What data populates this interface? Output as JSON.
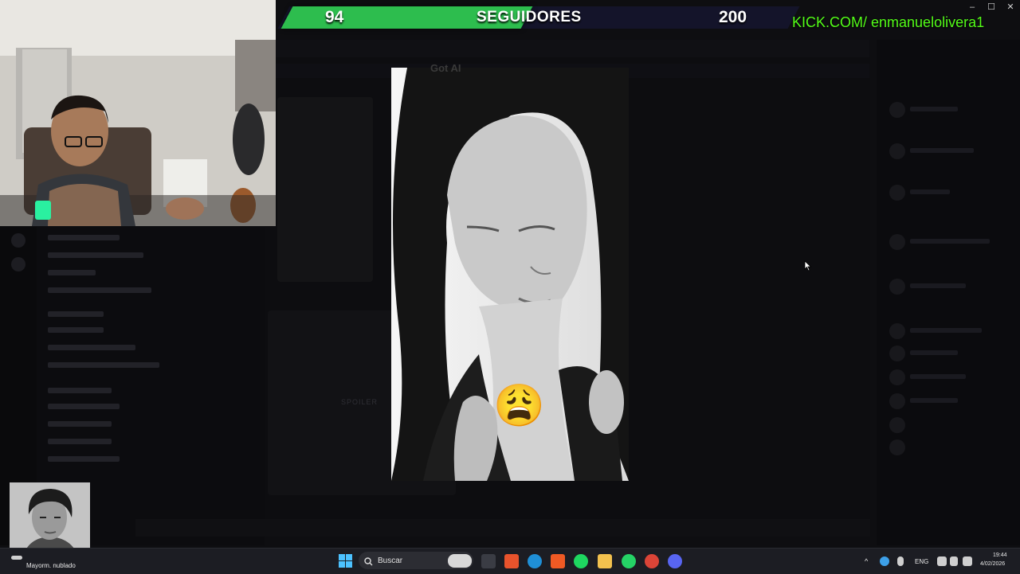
{
  "stream_overlay": {
    "follower_goal": {
      "current": "94",
      "label": "SEGUIDORES",
      "target": "200",
      "progress": 0.47
    },
    "channel_url": "KICK.COM/ enmanuelolivera1",
    "accent_color": "#2dbd4e",
    "url_color": "#53fc18"
  },
  "window_controls": {
    "minimize_label": "–",
    "maximize_label": "☐",
    "close_label": "✕"
  },
  "background_app": {
    "spoiler_label": "SPOILER"
  },
  "main_image": {
    "watermark": "Got AI",
    "reaction_emoji": "😩"
  },
  "taskbar": {
    "weather_text": "Mayorm. nublado",
    "search_placeholder": "Buscar",
    "language": "ENG",
    "time": "19:44",
    "date": "4/02/2026",
    "pinned_apps": [
      "windows-start",
      "search",
      "ai-app",
      "task-view",
      "office",
      "edge",
      "brave",
      "spotify",
      "file-explorer",
      "whatsapp",
      "chrome",
      "discord"
    ]
  }
}
